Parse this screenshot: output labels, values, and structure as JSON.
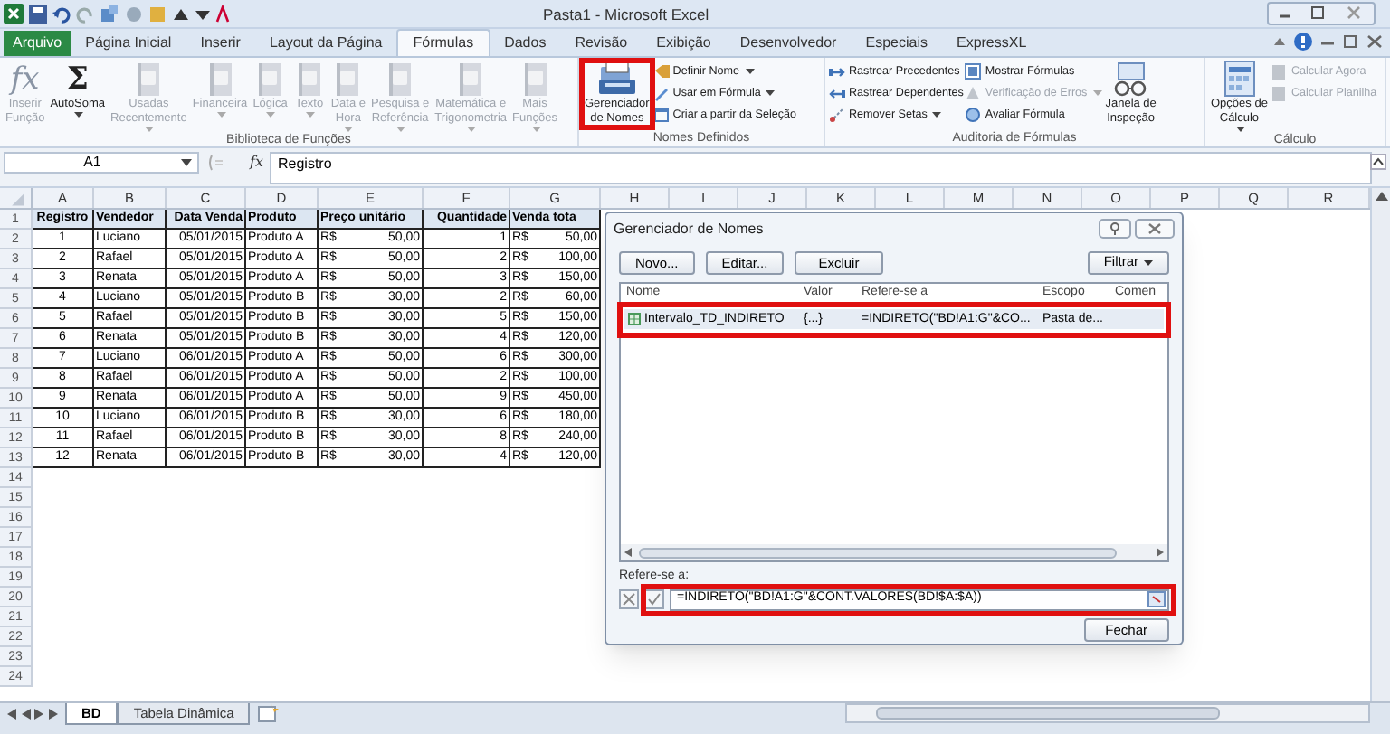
{
  "window": {
    "title": "Pasta1 - Microsoft Excel"
  },
  "tabs": [
    {
      "label": "Arquivo",
      "kind": "file",
      "selected": false
    },
    {
      "label": "Página Inicial",
      "kind": "tab",
      "selected": false
    },
    {
      "label": "Inserir",
      "kind": "tab",
      "selected": false
    },
    {
      "label": "Layout da Página",
      "kind": "tab",
      "selected": false
    },
    {
      "label": "Fórmulas",
      "kind": "tab",
      "selected": true
    },
    {
      "label": "Dados",
      "kind": "tab",
      "selected": false
    },
    {
      "label": "Revisão",
      "kind": "tab",
      "selected": false
    },
    {
      "label": "Exibição",
      "kind": "tab",
      "selected": false
    },
    {
      "label": "Desenvolvedor",
      "kind": "tab",
      "selected": false
    },
    {
      "label": "Especiais",
      "kind": "tab",
      "selected": false
    },
    {
      "label": "ExpressXL",
      "kind": "tab",
      "selected": false
    }
  ],
  "ribbon_groups": [
    {
      "label": "Biblioteca de Funções",
      "items": [
        {
          "kind": "large",
          "glyph": "fx",
          "label": "Inserir\nFunção",
          "disabled": true,
          "dropdown": false
        },
        {
          "kind": "large",
          "glyph": "Σ",
          "label": "AutoSoma",
          "disabled": false,
          "dropdown": true
        },
        {
          "kind": "large",
          "label": "Usadas\nRecentemente",
          "disabled": true,
          "dropdown": true
        },
        {
          "kind": "large",
          "label": "Financeira",
          "disabled": true,
          "dropdown": true
        },
        {
          "kind": "large",
          "label": "Lógica",
          "disabled": true,
          "dropdown": true
        },
        {
          "kind": "large",
          "label": "Texto",
          "disabled": true,
          "dropdown": true
        },
        {
          "kind": "large",
          "label": "Data e\nHora",
          "disabled": true,
          "dropdown": true
        },
        {
          "kind": "large",
          "label": "Pesquisa e\nReferência",
          "disabled": true,
          "dropdown": true
        },
        {
          "kind": "large",
          "label": "Matemática e\nTrigonometria",
          "disabled": true,
          "dropdown": true
        },
        {
          "kind": "large",
          "label": "Mais\nFunções",
          "disabled": true,
          "dropdown": true
        }
      ]
    },
    {
      "label": "Nomes Definidos",
      "items": [
        {
          "kind": "large",
          "label": "Gerenciador\nde Nomes",
          "disabled": false,
          "dropdown": false,
          "highlighted": true
        },
        {
          "kind": "small",
          "label": "Definir Nome",
          "disabled": false,
          "dropdown": true
        },
        {
          "kind": "small",
          "label": "Usar em Fórmula",
          "disabled": false,
          "dropdown": true
        },
        {
          "kind": "small",
          "label": "Criar a partir da Seleção",
          "disabled": false,
          "dropdown": false
        }
      ]
    },
    {
      "label": "Auditoria de Fórmulas",
      "items": [
        {
          "kind": "small",
          "label": "Rastrear Precedentes",
          "disabled": false,
          "dropdown": false
        },
        {
          "kind": "small",
          "label": "Rastrear Dependentes",
          "disabled": false,
          "dropdown": false
        },
        {
          "kind": "small",
          "label": "Remover Setas",
          "disabled": false,
          "dropdown": true
        },
        {
          "kind": "small",
          "label": "Mostrar Fórmulas",
          "disabled": false,
          "dropdown": false
        },
        {
          "kind": "small",
          "label": "Verificação de Erros",
          "disabled": true,
          "dropdown": true
        },
        {
          "kind": "small",
          "label": "Avaliar Fórmula",
          "disabled": false,
          "dropdown": false
        },
        {
          "kind": "large",
          "label": "Janela de\nInspeção",
          "disabled": false,
          "dropdown": false
        }
      ]
    },
    {
      "label": "Cálculo",
      "items": [
        {
          "kind": "large",
          "label": "Opções de\nCálculo",
          "disabled": false,
          "dropdown": true
        },
        {
          "kind": "small",
          "label": "Calcular Agora",
          "disabled": true,
          "dropdown": false
        },
        {
          "kind": "small",
          "label": "Calcular Planilha",
          "disabled": true,
          "dropdown": false
        }
      ]
    }
  ],
  "formula_bar": {
    "name_box": "A1",
    "fx": "fx",
    "value": "Registro"
  },
  "sheet": {
    "columns": [
      "A",
      "B",
      "C",
      "D",
      "E",
      "F",
      "G",
      "H",
      "I",
      "J",
      "K",
      "L",
      "M",
      "N",
      "O",
      "P",
      "Q",
      "R"
    ],
    "rows": [
      {
        "number": "1",
        "header": true,
        "cells": [
          "Registro",
          "Vendedor",
          "Data Venda",
          "Produto",
          "Preço unitário",
          "Quantidade",
          "Venda tota"
        ]
      },
      {
        "number": "2",
        "cells": [
          "1",
          "Luciano",
          "05/01/2015",
          "Produto A",
          {
            "currency": "R$",
            "amount": "50,00"
          },
          "1",
          {
            "currency": "R$",
            "amount": "50,00"
          }
        ]
      },
      {
        "number": "3",
        "cells": [
          "2",
          "Rafael",
          "05/01/2015",
          "Produto A",
          {
            "currency": "R$",
            "amount": "50,00"
          },
          "2",
          {
            "currency": "R$",
            "amount": "100,00"
          }
        ]
      },
      {
        "number": "4",
        "cells": [
          "3",
          "Renata",
          "05/01/2015",
          "Produto A",
          {
            "currency": "R$",
            "amount": "50,00"
          },
          "3",
          {
            "currency": "R$",
            "amount": "150,00"
          }
        ]
      },
      {
        "number": "5",
        "cells": [
          "4",
          "Luciano",
          "05/01/2015",
          "Produto B",
          {
            "currency": "R$",
            "amount": "30,00"
          },
          "2",
          {
            "currency": "R$",
            "amount": "60,00"
          }
        ]
      },
      {
        "number": "6",
        "cells": [
          "5",
          "Rafael",
          "05/01/2015",
          "Produto B",
          {
            "currency": "R$",
            "amount": "30,00"
          },
          "5",
          {
            "currency": "R$",
            "amount": "150,00"
          }
        ]
      },
      {
        "number": "7",
        "cells": [
          "6",
          "Renata",
          "05/01/2015",
          "Produto B",
          {
            "currency": "R$",
            "amount": "30,00"
          },
          "4",
          {
            "currency": "R$",
            "amount": "120,00"
          }
        ]
      },
      {
        "number": "8",
        "cells": [
          "7",
          "Luciano",
          "06/01/2015",
          "Produto A",
          {
            "currency": "R$",
            "amount": "50,00"
          },
          "6",
          {
            "currency": "R$",
            "amount": "300,00"
          }
        ]
      },
      {
        "number": "9",
        "cells": [
          "8",
          "Rafael",
          "06/01/2015",
          "Produto A",
          {
            "currency": "R$",
            "amount": "50,00"
          },
          "2",
          {
            "currency": "R$",
            "amount": "100,00"
          }
        ]
      },
      {
        "number": "10",
        "cells": [
          "9",
          "Renata",
          "06/01/2015",
          "Produto A",
          {
            "currency": "R$",
            "amount": "50,00"
          },
          "9",
          {
            "currency": "R$",
            "amount": "450,00"
          }
        ]
      },
      {
        "number": "11",
        "cells": [
          "10",
          "Luciano",
          "06/01/2015",
          "Produto B",
          {
            "currency": "R$",
            "amount": "30,00"
          },
          "6",
          {
            "currency": "R$",
            "amount": "180,00"
          }
        ]
      },
      {
        "number": "12",
        "cells": [
          "11",
          "Rafael",
          "06/01/2015",
          "Produto B",
          {
            "currency": "R$",
            "amount": "30,00"
          },
          "8",
          {
            "currency": "R$",
            "amount": "240,00"
          }
        ]
      },
      {
        "number": "13",
        "cells": [
          "12",
          "Renata",
          "06/01/2015",
          "Produto B",
          {
            "currency": "R$",
            "amount": "30,00"
          },
          "4",
          {
            "currency": "R$",
            "amount": "120,00"
          }
        ]
      },
      {
        "number": "14"
      },
      {
        "number": "15"
      },
      {
        "number": "16"
      },
      {
        "number": "17"
      },
      {
        "number": "18"
      },
      {
        "number": "19"
      },
      {
        "number": "20"
      },
      {
        "number": "21"
      },
      {
        "number": "22"
      },
      {
        "number": "23"
      },
      {
        "number": "24"
      }
    ]
  },
  "sheet_tabs": [
    {
      "label": "BD",
      "selected": true
    },
    {
      "label": "Tabela Dinâmica",
      "selected": false
    }
  ],
  "name_manager": {
    "title": "Gerenciador de Nomes",
    "buttons": [
      "Novo...",
      "Editar...",
      "Excluir"
    ],
    "filter_button": "Filtrar",
    "columns": [
      "Nome",
      "Valor",
      "Refere-se a",
      "Escopo",
      "Comen"
    ],
    "rows": [
      {
        "name": "Intervalo_TD_INDIRETO",
        "value": "{...}",
        "refers_to": "=INDIRETO(\"BD!A1:G\"&CO...",
        "scope": "Pasta de...",
        "selected": true,
        "highlighted": true
      }
    ],
    "refers_label": "Refere-se a:",
    "refers_value": "=INDIRETO(\"BD!A1:G\"&CONT.VALORES(BD!$A:$A))",
    "refers_highlighted": true,
    "close_button": "Fechar"
  }
}
